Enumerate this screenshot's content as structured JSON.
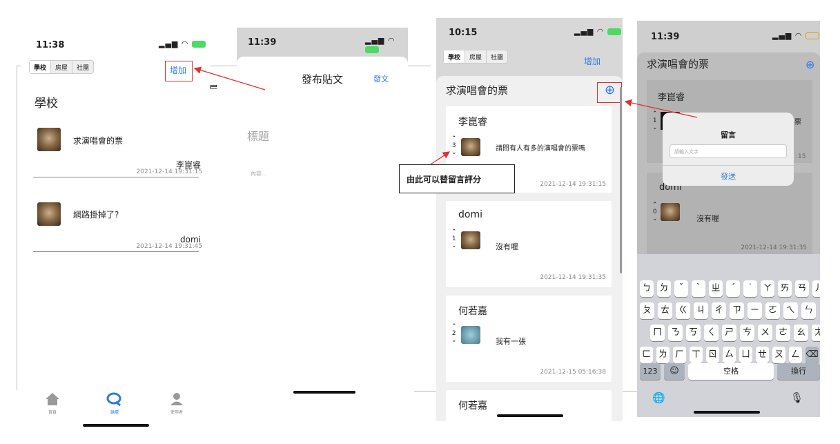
{
  "screen1": {
    "time": "11:38",
    "tabs": [
      "學校",
      "房屋",
      "社團"
    ],
    "add_label": "增加",
    "section_title": "學校",
    "posts": [
      {
        "title": "求演唱會的票",
        "author": "李崑睿",
        "date": "2021-12-14 19:31:15"
      },
      {
        "title": "網路掛掉了?",
        "author": "domi",
        "date": "2021-12-14 19:31:45"
      }
    ],
    "tabbar": [
      {
        "label": "首頁",
        "icon": "home-icon"
      },
      {
        "label": "論壇",
        "icon": "chat-icon"
      },
      {
        "label": "使用者",
        "icon": "user-icon"
      }
    ]
  },
  "screen2": {
    "time": "11:39",
    "title": "發布貼文",
    "submit_label": "發文",
    "title_placeholder": "標題",
    "content_placeholder": "內容...",
    "edge_glyph": "ᄅ"
  },
  "screen3": {
    "time": "10:15",
    "tabs": [
      "學校",
      "房屋",
      "社團"
    ],
    "add_label": "增加",
    "post_title": "求演唱會的票",
    "plus_glyph": "⊕",
    "comments": [
      {
        "author": "李崑睿",
        "votes": "3",
        "text": "請問有人有多的演唱會的票嗎",
        "date": "2021-12-14 19:31:15"
      },
      {
        "author": "domi",
        "votes": "1",
        "text": "沒有喔",
        "date": "2021-12-14 19:31:35"
      },
      {
        "author": "何若嘉",
        "votes": "2",
        "text": "我有一張",
        "date": "2021-12-15 05:16:38"
      },
      {
        "author": "何若嘉",
        "votes": "",
        "text": "",
        "date": ""
      }
    ],
    "callout": "由此可以替留言評分"
  },
  "screen4": {
    "time": "11:39",
    "post_title": "求演唱會的票",
    "plus_glyph": "⊕",
    "bg_author": "李崑睿",
    "bg_votes": "1",
    "bg_author2": "domi",
    "bg_votes2": "0",
    "bg_text2": "沒有喔",
    "bg_date2": "2021-12-14 19:31:35",
    "bg_partial1": "票",
    "bg_partial2": ":15",
    "dialog_title": "留言",
    "dialog_placeholder": "請輸入文字",
    "dialog_send": "發送",
    "keyboard_rows": [
      [
        "ㄅ",
        "ㄉ",
        "ˇ",
        "ˋ",
        "ㄓ",
        "ˊ",
        "˙",
        "ㄚ",
        "ㄞ",
        "ㄢ",
        "ㄦ"
      ],
      [
        "ㄆ",
        "ㄊ",
        "ㄍ",
        "ㄐ",
        "ㄔ",
        "ㄗ",
        "ㄧ",
        "ㄛ",
        "ㄟ",
        "ㄣ"
      ],
      [
        "ㄇ",
        "ㄋ",
        "ㄎ",
        "ㄑ",
        "ㄕ",
        "ㄘ",
        "ㄨ",
        "ㄜ",
        "ㄠ",
        "ㄤ"
      ],
      [
        "ㄈ",
        "ㄌ",
        "ㄏ",
        "ㄒ",
        "ㄖ",
        "ㄙ",
        "ㄩ",
        "ㄝ",
        "ㄡ",
        "ㄥ",
        "⌫"
      ]
    ],
    "key_123": "123",
    "key_emoji": "☺",
    "key_space": "空格",
    "key_return": "換行",
    "globe": "🌐",
    "mic": "🎙"
  }
}
